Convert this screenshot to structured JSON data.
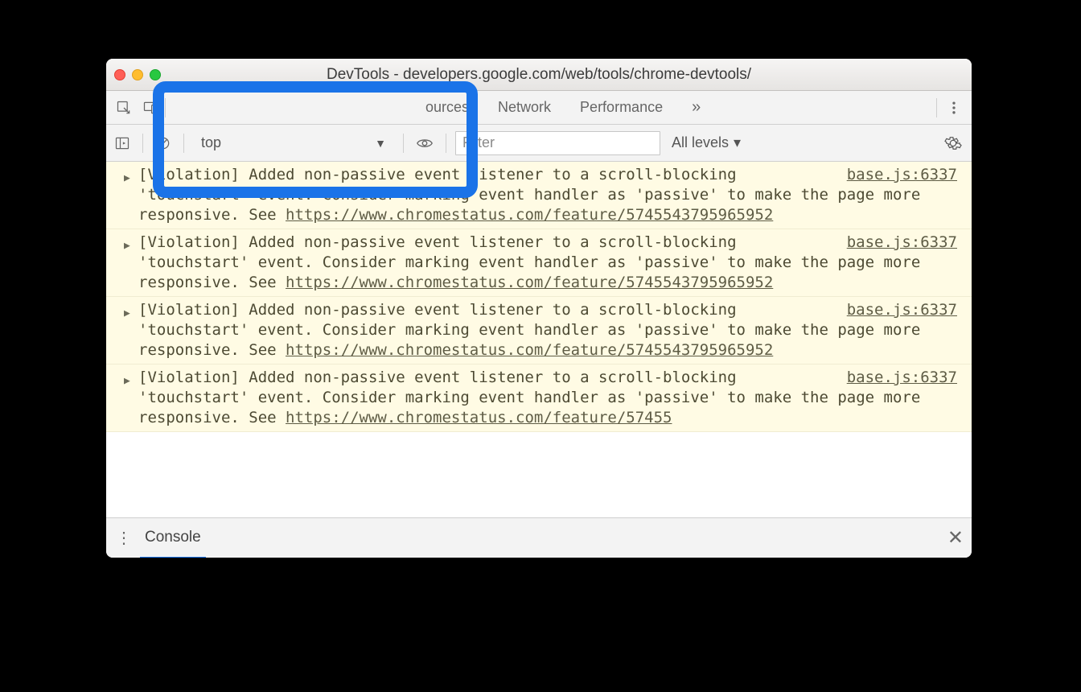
{
  "window": {
    "title": "DevTools - developers.google.com/web/tools/chrome-devtools/"
  },
  "tabs": {
    "sources": "ources",
    "network": "Network",
    "performance": "Performance",
    "overflow_glyph": "»"
  },
  "console": {
    "context": "top",
    "filter_placeholder": "Filter",
    "levels_label": "All levels",
    "levels_arrow": "▾"
  },
  "messages": [
    {
      "source": "base.js:6337",
      "prefix": "[Violation] Added non-passive event listener to a scroll-blocking 'touchstart' event. Consider marking event handler as 'passive' to make the page more responsive. See ",
      "link": "https://www.chromestatus.com/feature/5745543795965952"
    },
    {
      "source": "base.js:6337",
      "prefix": "[Violation] Added non-passive event listener to a scroll-blocking 'touchstart' event. Consider marking event handler as 'passive' to make the page more responsive. See ",
      "link": "https://www.chromestatus.com/feature/5745543795965952"
    },
    {
      "source": "base.js:6337",
      "prefix": "[Violation] Added non-passive event listener to a scroll-blocking 'touchstart' event. Consider marking event handler as 'passive' to make the page more responsive. See ",
      "link": "https://www.chromestatus.com/feature/5745543795965952"
    },
    {
      "source": "base.js:6337",
      "prefix": "[Violation] Added non-passive event listener to a scroll-blocking 'touchstart' event. Consider marking event handler as 'passive' to make the page more responsive. See ",
      "link": "https://www.chromestatus.com/feature/57455"
    }
  ],
  "drawer": {
    "tab": "Console"
  }
}
